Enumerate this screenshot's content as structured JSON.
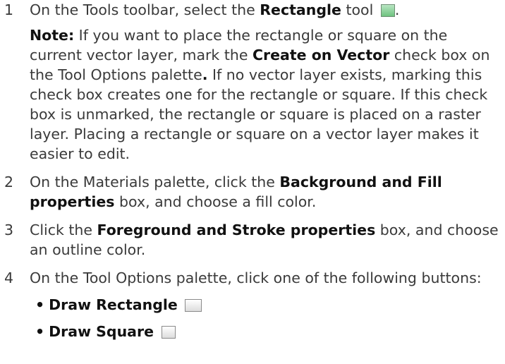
{
  "steps": [
    {
      "number": "1",
      "pre": "On the Tools toolbar, select the ",
      "bold": "Rectangle",
      "post": " tool",
      "icon": "rectangle-tool-icon",
      "end": "."
    },
    {
      "number": "2",
      "pre": "On the Materials palette, click the ",
      "bold": "Background and Fill properties",
      "post": " box, and choose a fill color."
    },
    {
      "number": "3",
      "pre": "Click the ",
      "bold": "Foreground and Stroke properties",
      "post": " box, and choose an outline color."
    },
    {
      "number": "4",
      "text": "On the Tool Options palette, click one of the following buttons:"
    }
  ],
  "note": {
    "label": "Note:",
    "t1": "  If you want to place the rectangle or square on the current vector layer, mark the ",
    "b1": "Create on Vector",
    "t2": " check box on the Tool Options palette",
    "b2": ".",
    "t3": " If no vector layer exists, marking this check box creates one for the rectangle or square. If this check box is unmarked, the rectangle or square is placed on a raster layer. Placing a rectangle or square on a vector layer makes it easier to edit."
  },
  "bullets": [
    {
      "bullet": "•",
      "label": "Draw Rectangle",
      "icon": "draw-rectangle-icon"
    },
    {
      "bullet": "•",
      "label": "Draw Square",
      "icon": "draw-square-icon"
    }
  ]
}
